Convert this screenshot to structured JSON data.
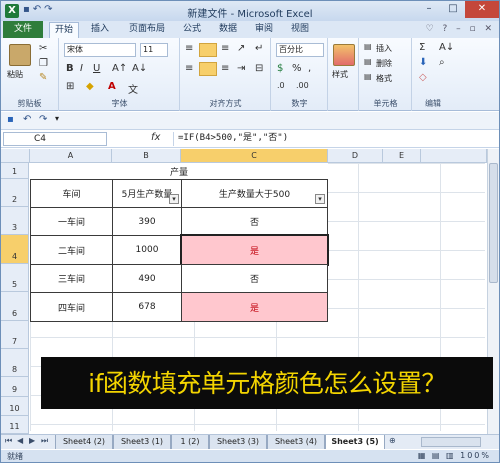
{
  "window": {
    "title": "新建文件 - Microsoft Excel"
  },
  "tabs": [
    "文件",
    "开始",
    "插入",
    "页面布局",
    "公式",
    "数据",
    "审阅",
    "视图"
  ],
  "ribbon": {
    "paste_label": "粘贴",
    "font_name": "宋体",
    "font_size": "11",
    "number_format": "百分比",
    "style_label": "样式",
    "insert_label": "插入",
    "delete_label": "删除",
    "format_label": "格式",
    "groups": [
      "剪贴板",
      "字体",
      "对齐方式",
      "数字",
      "单元格",
      "编辑"
    ],
    "bold": "B",
    "italic": "I",
    "underline": "U",
    "font_color": "A",
    "pct": "%",
    "comma": ",",
    "sum": "Σ",
    "sort": "Σ"
  },
  "formula_bar": {
    "name_box": "C4",
    "fx": "fx",
    "formula": "=IF(B4>500,\"是\",\"否\")"
  },
  "columns": [
    "A",
    "B",
    "C",
    "D",
    "E"
  ],
  "rows": [
    "1",
    "2",
    "3",
    "4",
    "5",
    "6",
    "7",
    "8",
    "9",
    "10",
    "11"
  ],
  "table": {
    "title": "产量",
    "headers": [
      "车间",
      "5月生产数量",
      "生产数量大于500"
    ],
    "rows": [
      {
        "workshop": "一车间",
        "qty": "390",
        "result": "否",
        "highlight": false
      },
      {
        "workshop": "二车间",
        "qty": "1000",
        "result": "是",
        "highlight": true
      },
      {
        "workshop": "三车间",
        "qty": "490",
        "result": "否",
        "highlight": false
      },
      {
        "workshop": "四车间",
        "qty": "678",
        "result": "是",
        "highlight": true
      }
    ],
    "highlight_color": "#ffc7ce",
    "highlight_text_color": "#c0000c"
  },
  "banner": {
    "text": "if函数填充单元格颜色怎么设置？",
    "color": "#f3d400"
  },
  "sheet_tabs": [
    "Sheet4 (2)",
    "Sheet3 (1)",
    "1 (2)",
    "Sheet3 (3)",
    "Sheet3 (4)",
    "Sheet3 (5)"
  ],
  "active_sheet": "Sheet3 (5)",
  "status": "就绪",
  "colors": {
    "accent": "#2f7d3a",
    "selection": "#f7cf6b"
  }
}
